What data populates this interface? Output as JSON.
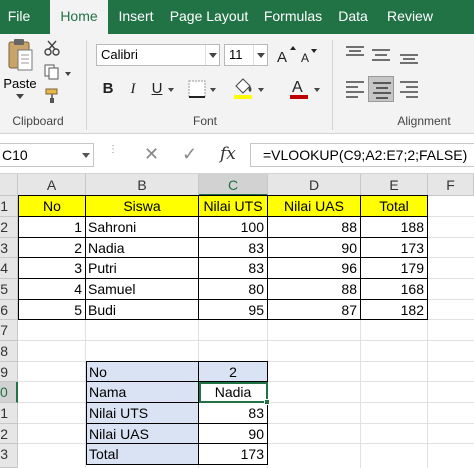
{
  "ribbon": {
    "tabs": [
      "File",
      "Home",
      "Insert",
      "Page Layout",
      "Formulas",
      "Data",
      "Review"
    ],
    "active_tab": "Home",
    "clipboard": {
      "paste_label": "Paste",
      "group_label": "Clipboard"
    },
    "font": {
      "name": "Calibri",
      "size": "11",
      "group_label": "Font",
      "bold": "B",
      "italic": "I",
      "underline": "U"
    },
    "alignment": {
      "group_label": "Alignment"
    },
    "colors": {
      "accent": "#217346",
      "font_color": "#c00000",
      "highlight": "#ffff00",
      "header_fill": "#ffff00",
      "lookup_fill": "#dae3f3"
    },
    "icons": [
      "cut-icon",
      "copy-icon",
      "format-painter-icon",
      "paste-icon",
      "grow-font-icon",
      "shrink-font-icon",
      "border-icon",
      "fill-color-icon",
      "font-color-icon",
      "align-top-icon",
      "align-middle-icon",
      "align-bottom-icon",
      "align-left-icon",
      "align-center-icon",
      "align-right-icon"
    ]
  },
  "formula_bar": {
    "name_box": "C10",
    "cancel_symbol": "✕",
    "enter_symbol": "✓",
    "fx_symbol": "fx",
    "formula": "=VLOOKUP(C9;A2:E7;2;FALSE)"
  },
  "grid": {
    "columns": [
      "A",
      "B",
      "C",
      "D",
      "E",
      "F"
    ],
    "rows": [
      "1",
      "2",
      "3",
      "4",
      "5",
      "6",
      "7",
      "8",
      "9",
      "0",
      "1",
      "2",
      "3"
    ],
    "selected_column": "C",
    "selected_row_label": "0",
    "header": [
      "No",
      "Siswa",
      "Nilai UTS",
      "Nilai UAS",
      "Total"
    ],
    "records": [
      {
        "no": "1",
        "siswa": "Sahroni",
        "uts": "100",
        "uas": "88",
        "total": "188"
      },
      {
        "no": "2",
        "siswa": "Nadia",
        "uts": "83",
        "uas": "90",
        "total": "173"
      },
      {
        "no": "3",
        "siswa": "Putri",
        "uts": "83",
        "uas": "96",
        "total": "179"
      },
      {
        "no": "4",
        "siswa": "Samuel",
        "uts": "80",
        "uas": "88",
        "total": "168"
      },
      {
        "no": "5",
        "siswa": "Budi",
        "uts": "95",
        "uas": "87",
        "total": "182"
      }
    ],
    "lookup": [
      {
        "label": "No",
        "value": "2"
      },
      {
        "label": "Nama",
        "value": "Nadia"
      },
      {
        "label": "Nilai UTS",
        "value": "83"
      },
      {
        "label": "Nilai UAS",
        "value": "90"
      },
      {
        "label": "Total",
        "value": "173"
      }
    ]
  }
}
